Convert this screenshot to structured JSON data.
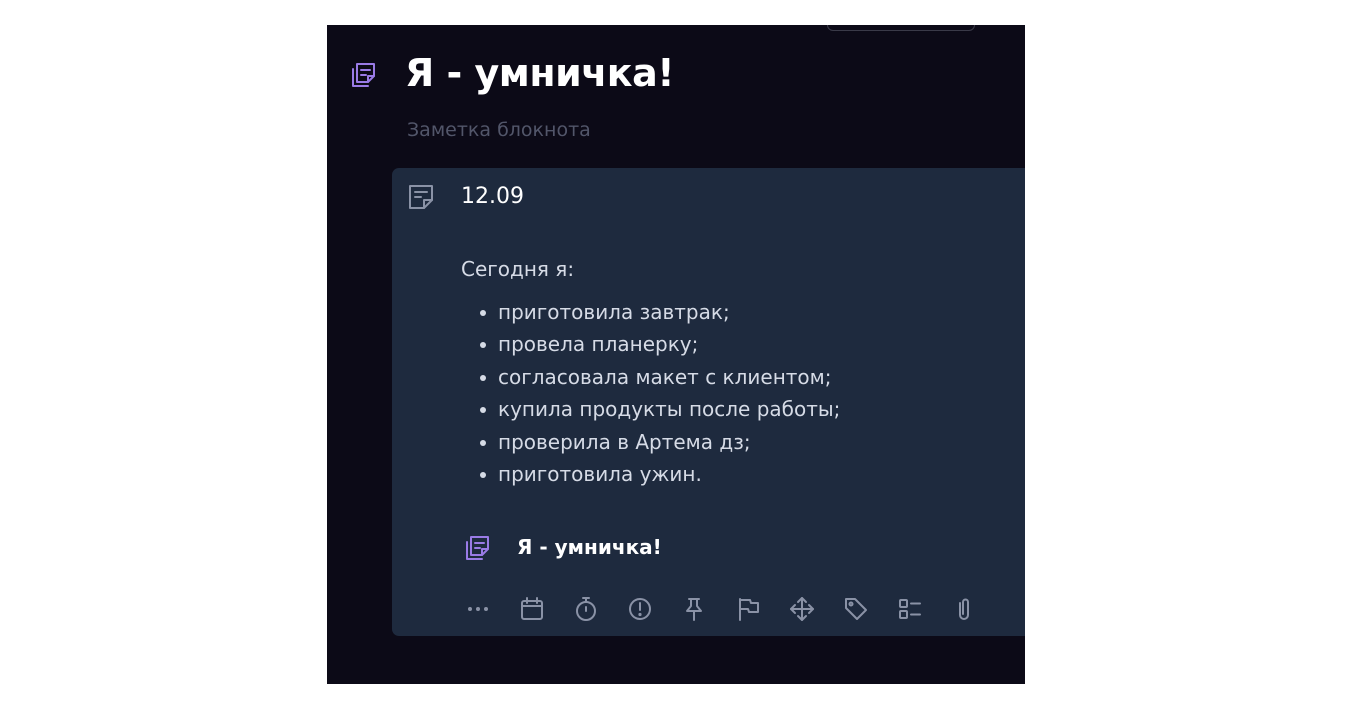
{
  "page": {
    "title": "Я - умничка!",
    "subtitle": "Заметка блокнота",
    "title_icon": "notebook-icon"
  },
  "note": {
    "icon": "note-icon",
    "date": "12.09",
    "intro": "Сегодня я:",
    "items": [
      "приготовила завтрак;",
      "провела планерку;",
      "согласовала макет с клиентом;",
      "купила продукты после работы;",
      "проверила в Артема дз;",
      "приготовила ужин."
    ],
    "link": {
      "icon": "notebook-icon",
      "label": "Я - умничка!"
    }
  },
  "toolbar": {
    "icons": [
      "more-icon",
      "calendar-icon",
      "timer-icon",
      "priority-icon",
      "pin-icon",
      "flag-icon",
      "move-icon",
      "tag-icon",
      "checklist-icon",
      "attachment-icon"
    ]
  },
  "colors": {
    "app_background": "#0c0a17",
    "card_background": "#1e2a3e",
    "accent_purple": "#9a7be6",
    "icon_gray": "#8a92a6",
    "subtitle_text": "#52566a"
  }
}
